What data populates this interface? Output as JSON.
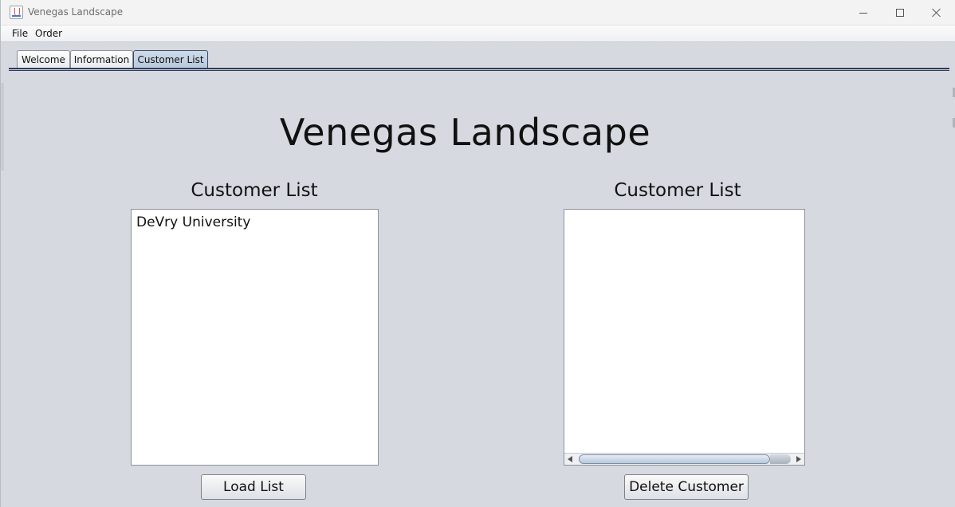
{
  "window": {
    "title": "Venegas Landscape"
  },
  "menu": {
    "items": [
      "File",
      "Order"
    ]
  },
  "tabs": [
    {
      "label": "Welcome",
      "selected": false
    },
    {
      "label": "Information",
      "selected": false
    },
    {
      "label": "Customer List",
      "selected": true
    }
  ],
  "main": {
    "title": "Venegas Landscape",
    "left_panel": {
      "label": "Customer List",
      "items": [
        "DeVry University"
      ],
      "button_label": "Load List"
    },
    "right_panel": {
      "label": "Customer List",
      "items": [],
      "button_label": "Delete Customer"
    }
  },
  "colors": {
    "background": "#d6d9e0",
    "selected_tab": "#b7c8dc",
    "tab_rule": "#2d3b5a"
  }
}
